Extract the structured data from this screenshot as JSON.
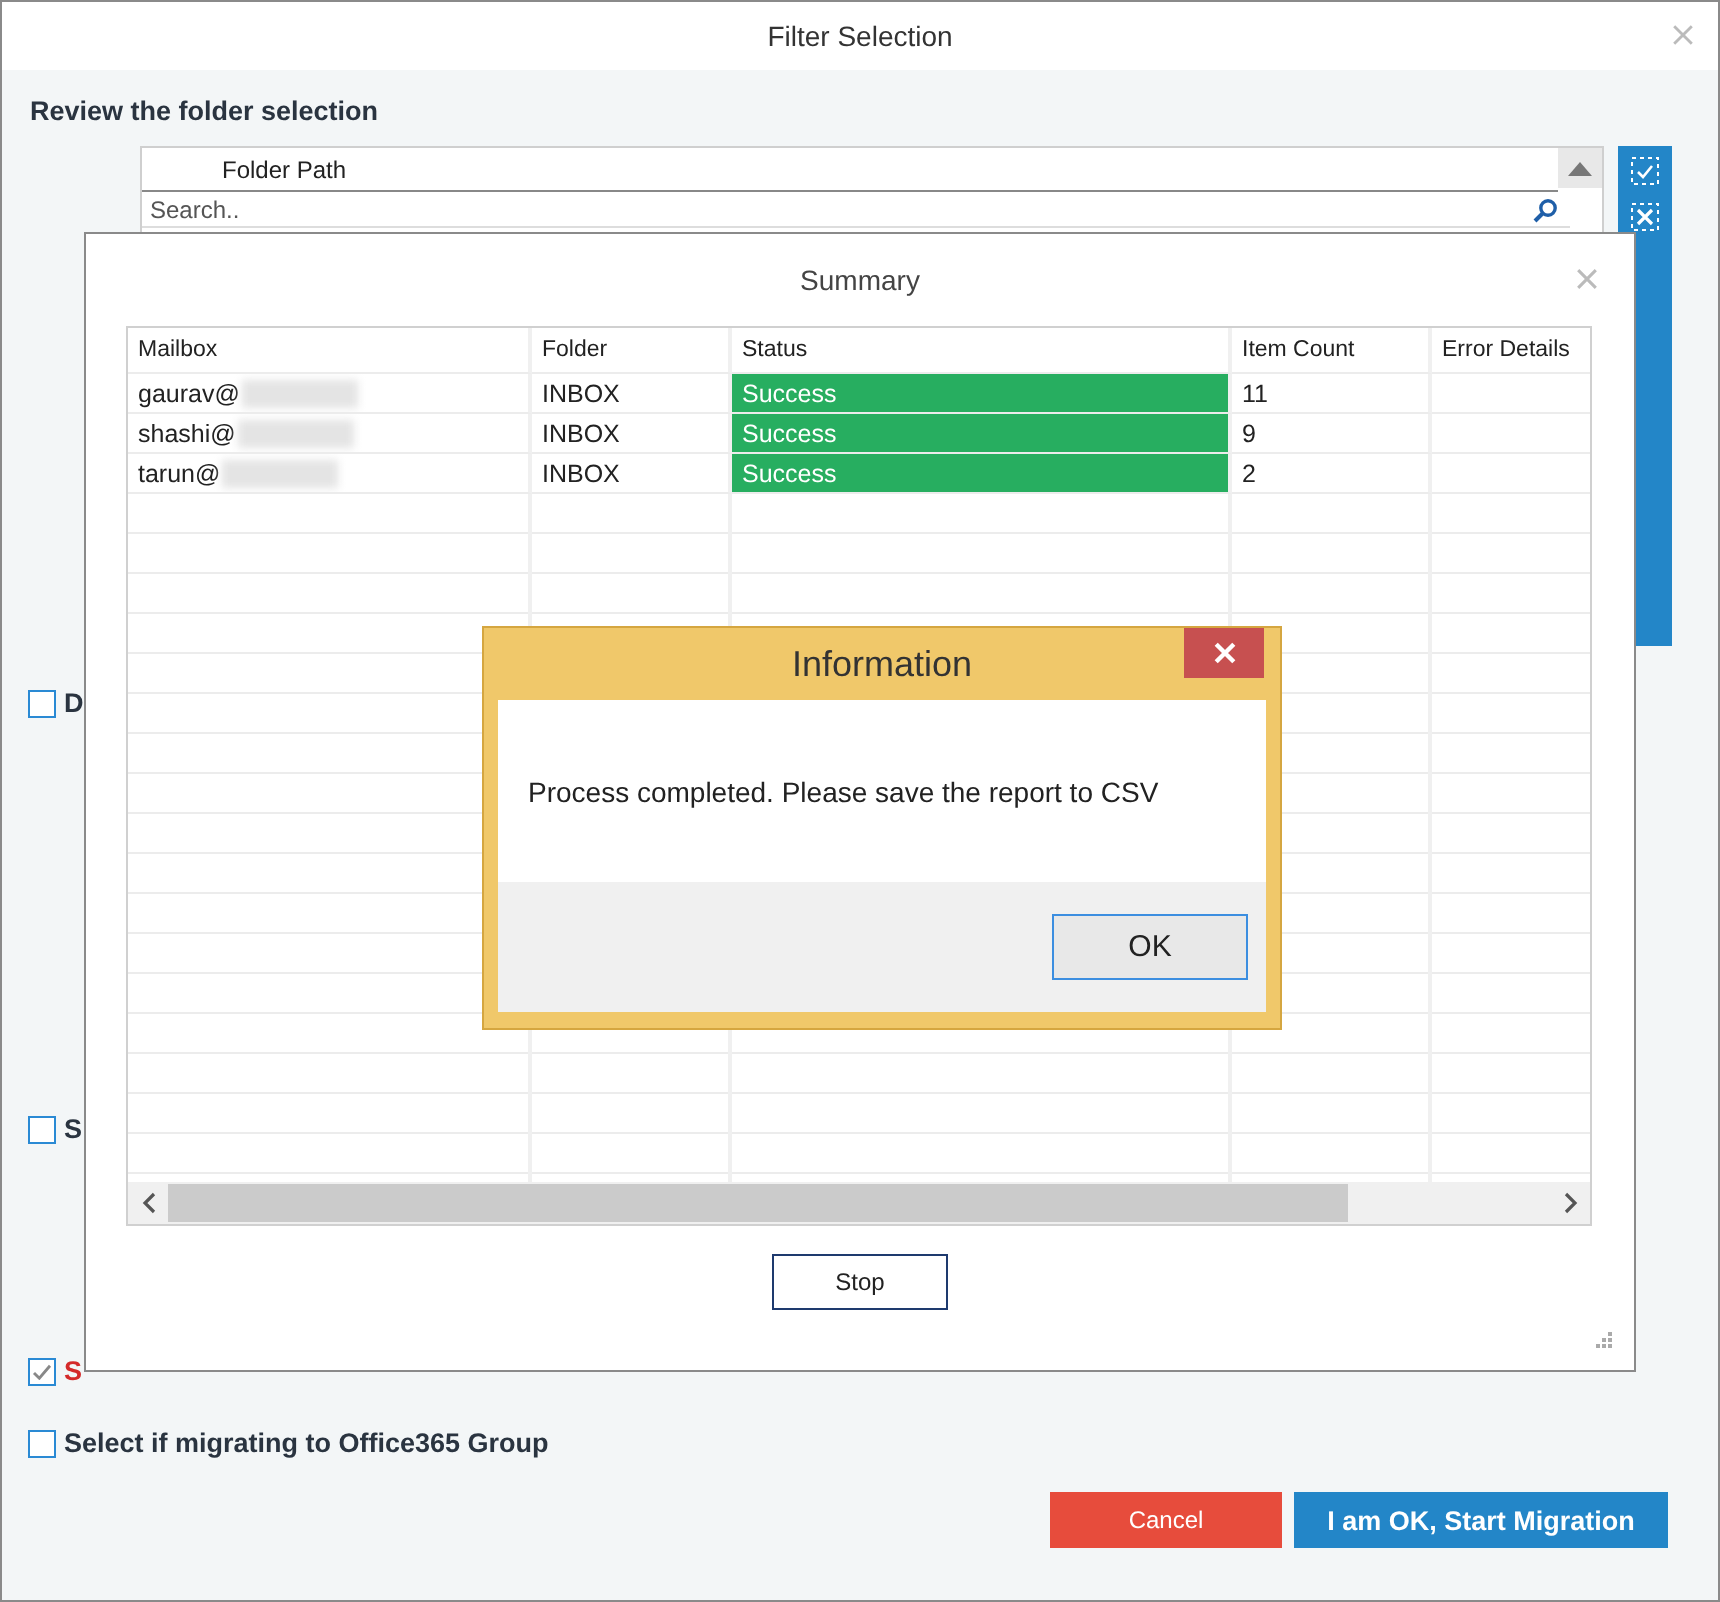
{
  "window": {
    "title": "Filter Selection"
  },
  "heading": "Review the folder selection",
  "folder_panel": {
    "column": "Folder Path",
    "search": {
      "placeholder": "Search.."
    }
  },
  "options": [
    {
      "label": "D",
      "checked": false,
      "warning": false
    },
    {
      "label": "S",
      "checked": false,
      "warning": false
    },
    {
      "label": "S",
      "checked": true,
      "warning": true
    },
    {
      "label": "Select if migrating to Office365 Group",
      "checked": false,
      "warning": false
    }
  ],
  "buttons": [
    {
      "label": "Cancel",
      "kind": "cancel"
    },
    {
      "label": "I am OK, Start Migration",
      "kind": "primary"
    }
  ],
  "summary": {
    "title": "Summary",
    "columns": [
      "Mailbox",
      "Folder",
      "Status",
      "Item Count",
      "Error Details"
    ],
    "rows": [
      {
        "mailbox": "gaurav@",
        "folder": "INBOX",
        "status": "Success",
        "item_count": "11"
      },
      {
        "mailbox": "shashi@",
        "folder": "INBOX",
        "status": "Success",
        "item_count": "9"
      },
      {
        "mailbox": "tarun@",
        "folder": "INBOX",
        "status": "Success",
        "item_count": "2"
      }
    ],
    "stop_button": "Stop"
  },
  "information": {
    "title": "Information",
    "message": "Process completed. Please save the report to CSV",
    "ok_button": "OK"
  }
}
